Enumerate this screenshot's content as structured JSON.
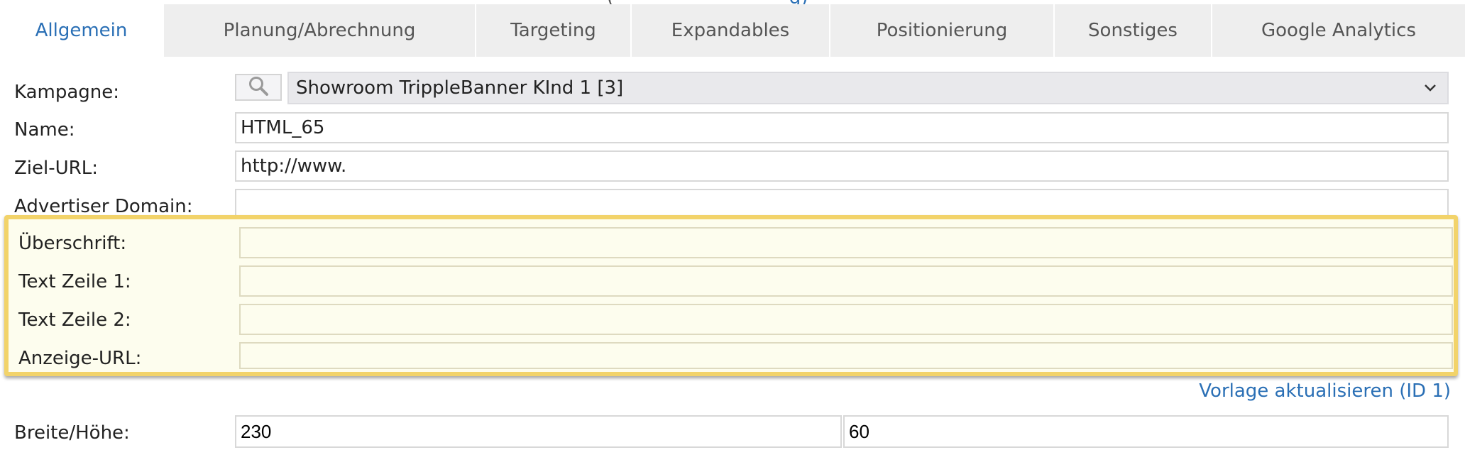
{
  "top_cut": {
    "part1": "(",
    "part2": "g)"
  },
  "tabs": [
    {
      "label": "Allgemein",
      "active": true
    },
    {
      "label": "Planung/Abrechnung"
    },
    {
      "label": "Targeting"
    },
    {
      "label": "Expandables"
    },
    {
      "label": "Positionierung"
    },
    {
      "label": "Sonstiges"
    },
    {
      "label": "Google Analytics"
    }
  ],
  "form": {
    "kampagne": {
      "label": "Kampagne:",
      "value": "Showroom TrippleBanner KInd 1 [3]"
    },
    "name": {
      "label": "Name:",
      "value": "HTML_65"
    },
    "ziel_url": {
      "label": "Ziel-URL:",
      "value": "http://www."
    },
    "advertiser_domain": {
      "label": "Advertiser Domain:",
      "value": ""
    },
    "ueberschrift": {
      "label": "Überschrift:",
      "value": ""
    },
    "text_zeile_1": {
      "label": "Text Zeile 1:",
      "value": ""
    },
    "text_zeile_2": {
      "label": "Text Zeile 2:",
      "value": ""
    },
    "anzeige_url": {
      "label": "Anzeige-URL:",
      "value": ""
    },
    "vorlage_link": "Vorlage aktualisieren (ID 1)",
    "breite_hoehe": {
      "label": "Breite/Höhe:",
      "width": "230",
      "height": "60"
    }
  },
  "colors": {
    "accent": "#2a6fb5",
    "highlight_border": "#f2d36a",
    "highlight_bg": "#fdfdee"
  }
}
